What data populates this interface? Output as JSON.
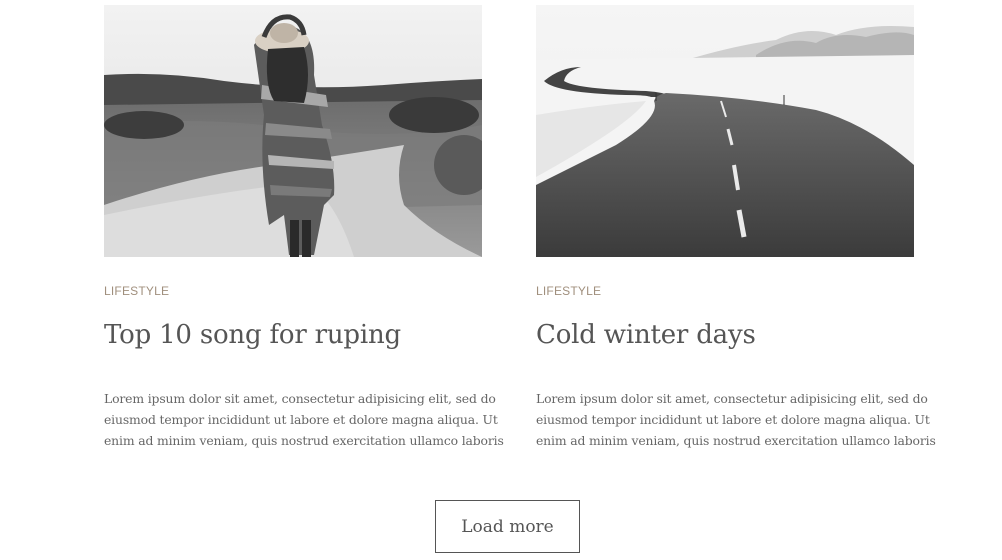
{
  "posts": [
    {
      "image_alt": "Woman in hat and striped cardigan on a gravel road",
      "category": "LIFESTYLE",
      "title": "Top 10 song for ruping",
      "excerpt_lines": [
        "Lorem ipsum dolor sit amet, consectetur adipisicing elit, sed do",
        "eiusmod tempor incididunt ut labore et dolore magna aliqua. Ut",
        "enim ad minim veniam, quis nostrud exercitation ullamco laboris"
      ]
    },
    {
      "image_alt": "Winding road through a snowy landscape",
      "category": "LIFESTYLE",
      "title": "Cold winter days",
      "excerpt_lines": [
        "Lorem ipsum dolor sit amet, consectetur adipisicing elit, sed do",
        "eiusmod tempor incididunt ut labore et dolore magna aliqua. Ut",
        "enim ad minim veniam, quis nostrud exercitation ullamco laboris"
      ]
    }
  ],
  "load_more_label": "Load more",
  "colors": {
    "category": "#a08f7d",
    "title": "#555555",
    "text": "#666666",
    "button_border": "#555555"
  }
}
